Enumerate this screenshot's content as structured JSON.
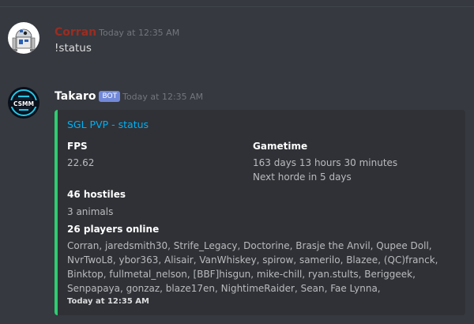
{
  "messages": [
    {
      "author": "Corran",
      "author_color": "#992d22",
      "timestamp": "Today at 12:35 AM",
      "content": "!status",
      "avatar_icon": "r2d2-avatar-icon"
    },
    {
      "author": "Takaro",
      "author_color": "#ffffff",
      "bot_tag": "BOT",
      "timestamp": "Today at 12:35 AM",
      "avatar_icon": "csmm-logo-avatar-icon",
      "embed": {
        "accent_color": "#2ecc71",
        "title": "SGL PVP - status",
        "fps_label": "FPS",
        "fps_value": "22.62",
        "gametime_label": "Gametime",
        "gametime_value": "163 days 13 hours 30 minutes",
        "next_horde": "Next horde in 5 days",
        "hostiles_label": "46 hostiles",
        "animals_value": "3 animals",
        "players_label": "26 players online",
        "players_list": "Corran, jaredsmith30, Strife_Legacy, Doctorine, Brasje the Anvil, Qupee Doll, NvrTwoL8, ybor363, Alisair, VanWhiskey, spirow, samerilo, Blazee, (QC)franck, Binktop, fullmetal_nelson, [BBF]hisgun, mike-chill, ryan.stults, Beriggeek, Senpapaya, gonzaz, blaze17en, NightimeRaider, Sean, Fae Lynna,",
        "footer": "Today at 12:35 AM"
      }
    }
  ],
  "colors": {
    "background": "#36393f",
    "embed_background": "#2f3136",
    "link": "#00b0f4",
    "timestamp": "#72767d",
    "bot_tag": "#7289da"
  }
}
